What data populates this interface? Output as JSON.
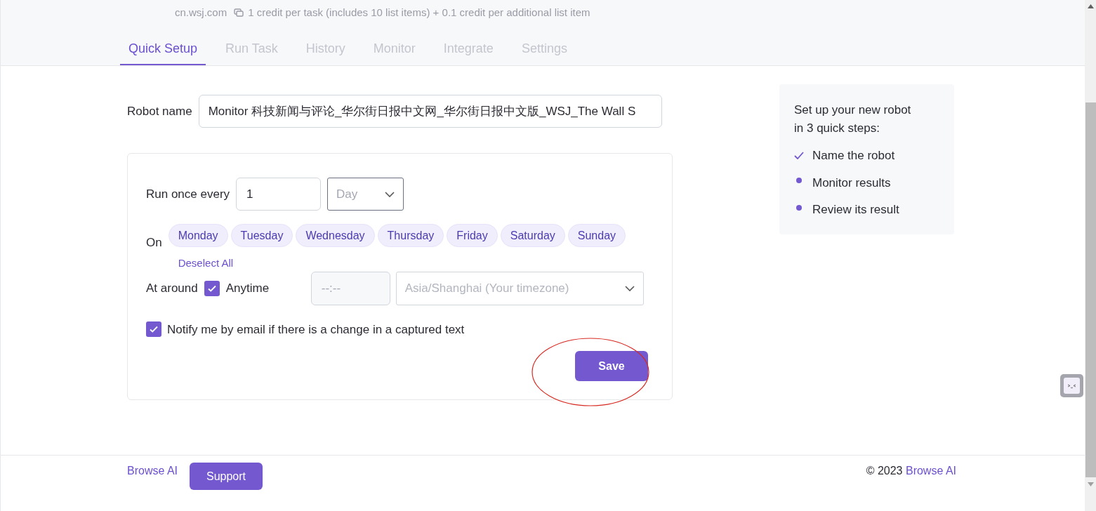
{
  "header": {
    "domain": "cn.wsj.com",
    "credit_info": "1 credit per task (includes 10 list items) + 0.1 credit per additional list item"
  },
  "tabs": [
    {
      "label": "Quick Setup",
      "selected": true
    },
    {
      "label": "Run Task",
      "selected": false
    },
    {
      "label": "History",
      "selected": false
    },
    {
      "label": "Monitor",
      "selected": false
    },
    {
      "label": "Integrate",
      "selected": false
    },
    {
      "label": "Settings",
      "selected": false
    }
  ],
  "robot_name": {
    "label": "Robot name",
    "value": "Monitor 科技新闻与评论_华尔街日报中文网_华尔街日报中文版_WSJ_The Wall S"
  },
  "schedule": {
    "run_label": "Run once every",
    "interval": "1",
    "unit_placeholder": "Day",
    "on_label": "On",
    "days": [
      {
        "label": "Monday",
        "selected": true
      },
      {
        "label": "Tuesday",
        "selected": true
      },
      {
        "label": "Wednesday",
        "selected": true
      },
      {
        "label": "Thursday",
        "selected": true
      },
      {
        "label": "Friday",
        "selected": true
      },
      {
        "label": "Saturday",
        "selected": true
      },
      {
        "label": "Sunday",
        "selected": true
      }
    ],
    "deselect_all": "Deselect All",
    "at_label": "At around",
    "anytime": {
      "label": "Anytime",
      "checked": true
    },
    "time_placeholder": "--:--",
    "timezone_placeholder": "Asia/Shanghai (Your timezone)",
    "notify": {
      "label": "Notify me by email if there is a change in a captured text",
      "checked": true
    },
    "save": "Save"
  },
  "steps": {
    "title": "Set up your new robot in 3 quick steps:",
    "items": [
      {
        "label": "Name the robot",
        "kind": "done"
      },
      {
        "label": "Monitor results",
        "kind": "pending"
      },
      {
        "label": "Review its result",
        "kind": "pending"
      }
    ]
  },
  "footer": {
    "brand_link": "Browse AI",
    "support": "Support",
    "copyright": "© 2023",
    "copyright_link": "Browse AI"
  }
}
